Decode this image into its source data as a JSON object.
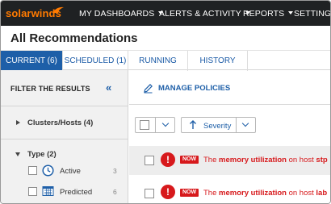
{
  "brand": {
    "logo_text": "solarwinds",
    "accent": "#ff7a00"
  },
  "nav": {
    "items": [
      {
        "label": "MY DASHBOARDS"
      },
      {
        "label": "ALERTS & ACTIVITY"
      },
      {
        "label": "REPORTS"
      },
      {
        "label": "SETTINGS"
      }
    ]
  },
  "page": {
    "title": "All Recommendations"
  },
  "tabs": [
    {
      "label": "CURRENT (6)",
      "active": true
    },
    {
      "label": "SCHEDULED (1)",
      "active": false
    },
    {
      "label": "RUNNING",
      "active": false
    },
    {
      "label": "HISTORY",
      "active": false
    }
  ],
  "filter": {
    "heading": "FILTER THE RESULTS",
    "collapse_icon": "double-chevron-left-icon",
    "groups": [
      {
        "label": "Clusters/Hosts (4)",
        "expanded": false
      },
      {
        "label": "Type (2)",
        "expanded": true,
        "items": [
          {
            "label": "Active",
            "count": "3",
            "icon": "clock-icon"
          },
          {
            "label": "Predicted",
            "count": "6",
            "icon": "calendar-icon"
          }
        ]
      }
    ]
  },
  "toolbar": {
    "manage_label": "MANAGE POLICIES",
    "sort_label": "Severity"
  },
  "rows": [
    {
      "badge": "NOW",
      "prefix": "The ",
      "metric": "memory utilization",
      "middle": " on host ",
      "host": "stp"
    },
    {
      "badge": "NOW",
      "prefix": "The ",
      "metric": "memory utilization",
      "middle": " on host ",
      "host": "lab"
    }
  ],
  "colors": {
    "nav_bg": "#1f2123",
    "tab_active": "#1e5fa8",
    "alert_red": "#d7191c",
    "link_blue": "#1e5fa8"
  }
}
